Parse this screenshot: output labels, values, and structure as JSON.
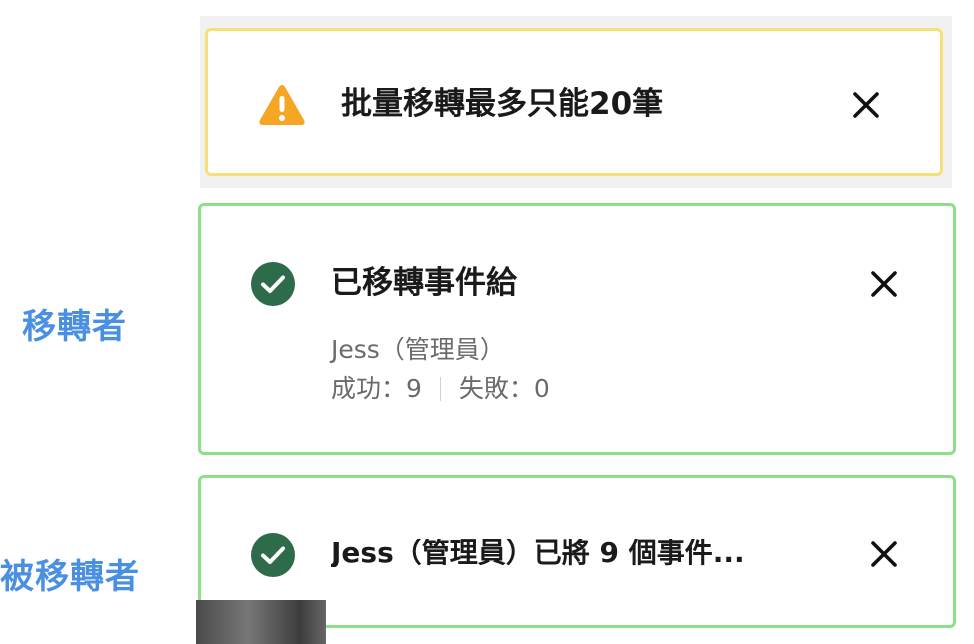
{
  "labels": {
    "sender": "移轉者",
    "receiver": "被移轉者"
  },
  "warning_toast": {
    "icon": "warning-triangle-icon",
    "title": "批量移轉最多只能20筆",
    "close_icon": "close-icon"
  },
  "success_toast_sender": {
    "icon": "check-circle-icon",
    "title": "已移轉事件給",
    "recipient": "Jess（管理員）",
    "success_label": "成功：9",
    "failure_label": "失敗：0",
    "close_icon": "close-icon"
  },
  "success_toast_receiver": {
    "icon": "check-circle-icon",
    "title": "Jess（管理員）已將 9 個事件...",
    "close_icon": "close-icon"
  },
  "colors": {
    "label_blue": "#4a90e2",
    "warning_border": "#f7df7a",
    "warning_icon": "#f5a623",
    "success_border": "#8fdf8a",
    "success_icon": "#2e6b4a"
  }
}
